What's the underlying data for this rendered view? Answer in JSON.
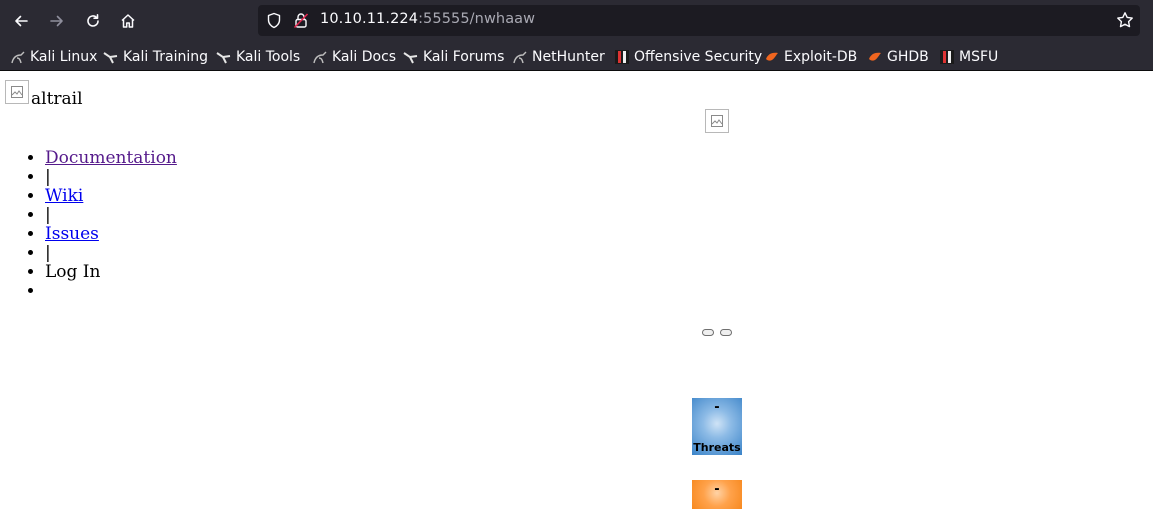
{
  "browser": {
    "url_host": "10.10.11.224",
    "url_path": ":55555/nwhaaw",
    "bookmarks": [
      {
        "label": "Kali Linux",
        "icon": "kali-dragon-icon"
      },
      {
        "label": "Kali Training",
        "icon": "kali-training-icon"
      },
      {
        "label": "Kali Tools",
        "icon": "kali-tools-icon"
      },
      {
        "label": "Kali Docs",
        "icon": "kali-docs-icon"
      },
      {
        "label": "Kali Forums",
        "icon": "kali-forums-icon"
      },
      {
        "label": "NetHunter",
        "icon": "nethunter-icon"
      },
      {
        "label": "Offensive Security",
        "icon": "offsec-icon"
      },
      {
        "label": "Exploit-DB",
        "icon": "exploit-db-icon"
      },
      {
        "label": "GHDB",
        "icon": "ghdb-icon"
      },
      {
        "label": "MSFU",
        "icon": "msfu-icon"
      }
    ]
  },
  "page": {
    "logo_text": "altrail",
    "menu": [
      {
        "label": "Documentation",
        "type": "link",
        "visited": true
      },
      {
        "label": "|",
        "type": "separator"
      },
      {
        "label": "Wiki",
        "type": "link",
        "visited": false
      },
      {
        "label": "|",
        "type": "separator"
      },
      {
        "label": "Issues",
        "type": "link",
        "visited": false
      },
      {
        "label": "|",
        "type": "separator"
      },
      {
        "label": "Log In",
        "type": "text"
      },
      {
        "label": "",
        "type": "text"
      }
    ],
    "stats": {
      "threats": {
        "value": "-",
        "label": "Threats"
      },
      "events": {
        "value": "-",
        "label": ""
      }
    }
  },
  "colors": {
    "chrome_bg": "#2b2a33",
    "urlbar_bg": "#1c1b22",
    "link": "#0000ee",
    "link_visited": "#551a8b",
    "threats_box": "#3a83c8",
    "events_box": "#f7891f"
  }
}
